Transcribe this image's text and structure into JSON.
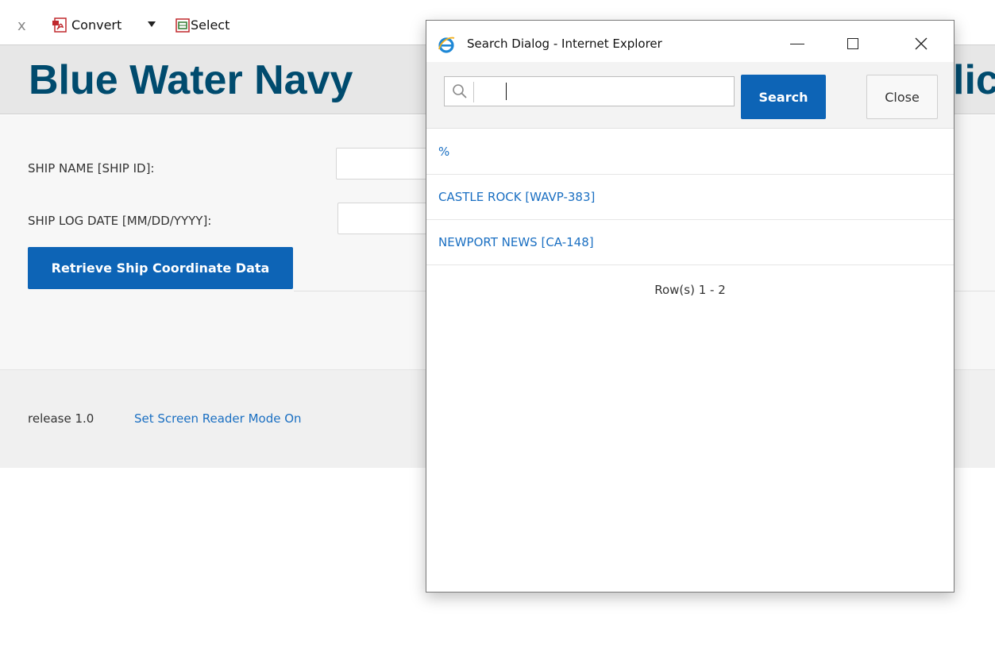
{
  "toolbar": {
    "close_glyph": "x",
    "convert_label": "Convert",
    "select_label": "Select"
  },
  "banner": {
    "title_left": "Blue Water Navy",
    "title_right": "lic"
  },
  "form": {
    "ship_name_label": "SHIP NAME [SHIP ID]:",
    "ship_name_value": "",
    "ship_log_date_label": "SHIP LOG DATE [MM/DD/YYYY]:",
    "ship_log_date_value": "",
    "retrieve_button_label": "Retrieve Ship Coordinate Data"
  },
  "footer": {
    "release_label": "release 1.0",
    "screen_reader_link": "Set Screen Reader Mode On"
  },
  "dialog": {
    "title": "Search Dialog - Internet Explorer",
    "search_value": "",
    "search_button_label": "Search",
    "close_button_label": "Close",
    "results": [
      {
        "label": "%"
      },
      {
        "label": "CASTLE ROCK [WAVP-383]"
      },
      {
        "label": "NEWPORT NEWS [CA-148]"
      }
    ],
    "pagination": "Row(s) 1 - 2"
  },
  "colors": {
    "accent": "#0d64b6",
    "link": "#1a6fc2",
    "banner_title": "#004b6e"
  }
}
